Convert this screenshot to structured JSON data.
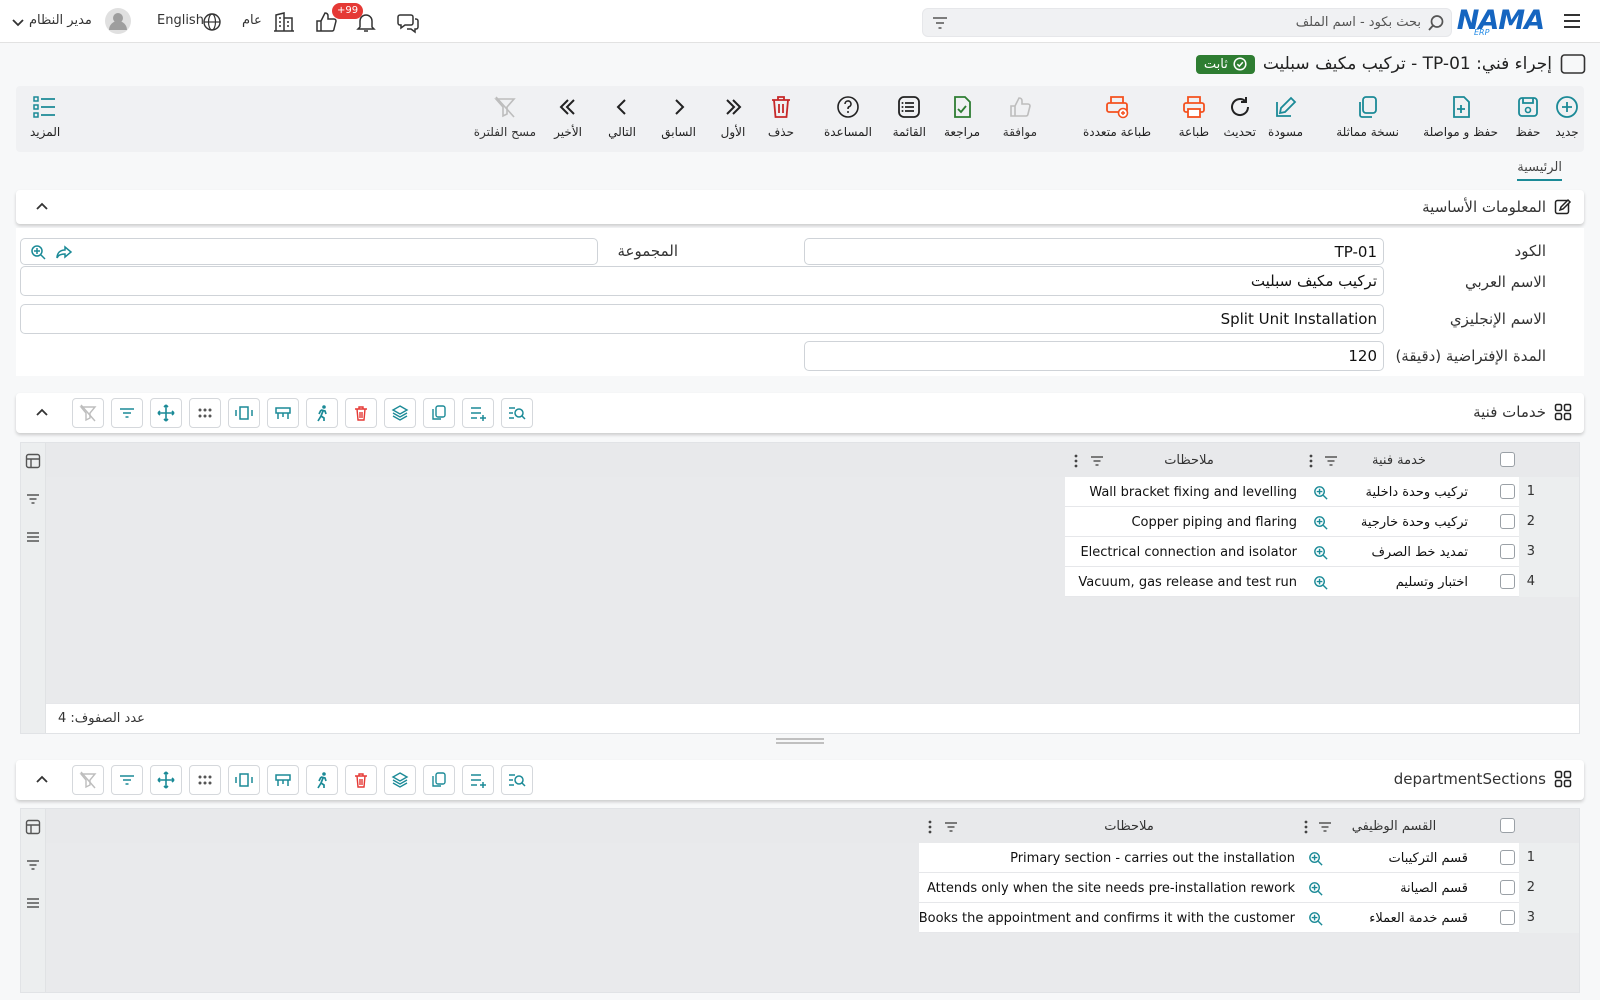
{
  "topbar": {
    "logo_text": "NAMA",
    "logo_sub": "ERP",
    "search_placeholder": "بحث بكود - اسم الملف",
    "notifications_badge": "99+",
    "branch_label": "عام",
    "language_label": "English",
    "user_label": "مدير النظام"
  },
  "page": {
    "title": "إجراء فني: TP-01 - تركيب مكيف سبليت",
    "status": "ثابت"
  },
  "toolbar": {
    "new": "جديد",
    "save": "حفظ",
    "save_continue": "حفظ و مواصلة",
    "duplicate": "نسخة مماثلة",
    "draft": "مسودة",
    "refresh": "تحديث",
    "print": "طباعة",
    "multi_print": "طباعة متعددة",
    "approve": "موافقة",
    "review": "مراجعة",
    "list": "القائمة",
    "help": "المساعدة",
    "delete": "حذف",
    "first": "الأول",
    "previous": "السابق",
    "next": "التالي",
    "last": "الأخير",
    "clear_filter": "مسح الفلترة",
    "more": "المزيد"
  },
  "tabs": {
    "main": "الرئيسية"
  },
  "basic_info": {
    "title": "المعلومات الأساسية",
    "code_label": "الكود",
    "code_value": "TP-01",
    "group_label": "المجموعة",
    "group_value": "",
    "arabic_name_label": "الاسم العربي",
    "arabic_name_value": "تركيب مكيف سبليت",
    "english_name_label": "الاسم الإنجليزي",
    "english_name_value": "Split Unit Installation",
    "duration_label": "المدة الإفتراضية (دقيقة)",
    "duration_value": "120"
  },
  "services": {
    "title": "خدمات فنية",
    "col_service": "خدمة فنية",
    "col_notes": "ملاحظات",
    "rows": [
      {
        "n": "1",
        "service": "تركيب وحدة داخلية",
        "notes": "Wall bracket fixing and levelling"
      },
      {
        "n": "2",
        "service": "تركيب وحدة خارجية",
        "notes": "Copper piping and flaring"
      },
      {
        "n": "3",
        "service": "تمديد خط الصرف",
        "notes": "Electrical connection and isolator"
      },
      {
        "n": "4",
        "service": "اختبار وتسليم",
        "notes": "Vacuum, gas release and test run"
      }
    ],
    "row_count": "عدد الصفوف: 4"
  },
  "departments": {
    "title": "departmentSections",
    "col_section": "القسم الوظيفي",
    "col_notes": "ملاحظات",
    "rows": [
      {
        "n": "1",
        "section": "قسم التركيبات",
        "notes": "Primary section - carries out the installation"
      },
      {
        "n": "2",
        "section": "قسم الصيانة",
        "notes": "Attends only when the site needs pre-installation rework"
      },
      {
        "n": "3",
        "section": "قسم خدمة العملاء",
        "notes": "Books the appointment and confirms it with the customer"
      }
    ]
  },
  "colors": {
    "accent": "#1b8a97",
    "brand": "#1565c0",
    "status": "#2e7d32",
    "danger": "#e53935",
    "print": "#f4511e"
  }
}
